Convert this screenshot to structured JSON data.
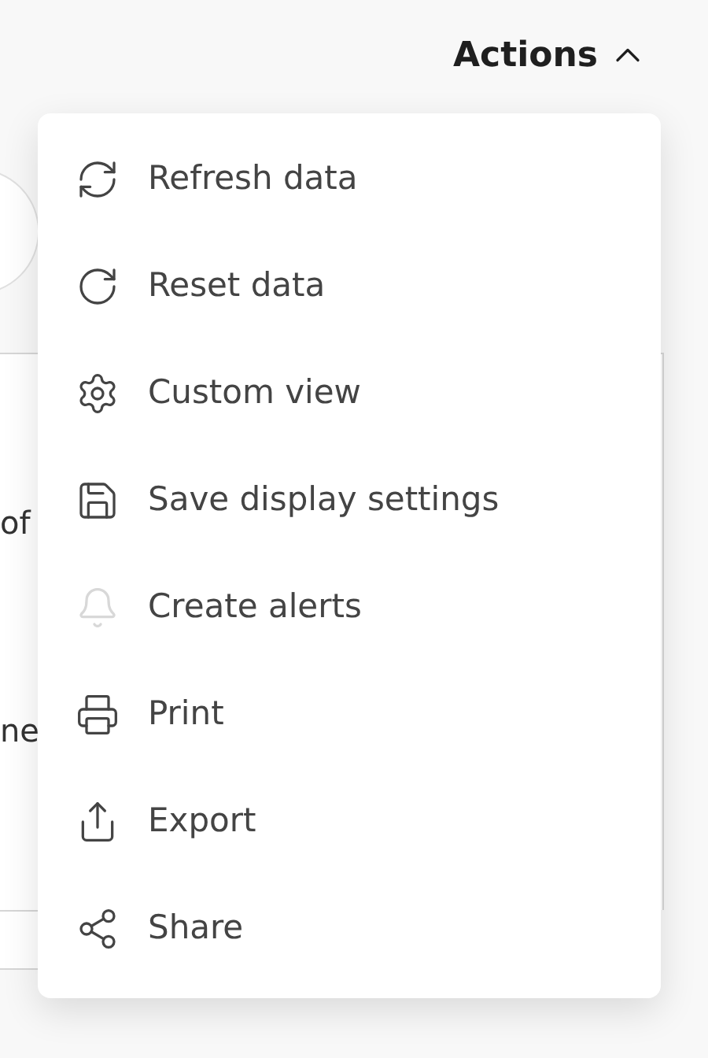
{
  "actions_button": {
    "label": "Actions",
    "expanded": true
  },
  "background_texts": [
    "of",
    "ne"
  ],
  "menu": [
    {
      "label": "Refresh data",
      "disabled": false
    },
    {
      "label": "Reset data",
      "disabled": false
    },
    {
      "label": "Custom view",
      "disabled": false
    },
    {
      "label": "Save display settings",
      "disabled": false
    },
    {
      "label": "Create alerts",
      "disabled": true
    },
    {
      "label": "Print",
      "disabled": false
    },
    {
      "label": "Export",
      "disabled": false
    },
    {
      "label": "Share",
      "disabled": false
    }
  ]
}
